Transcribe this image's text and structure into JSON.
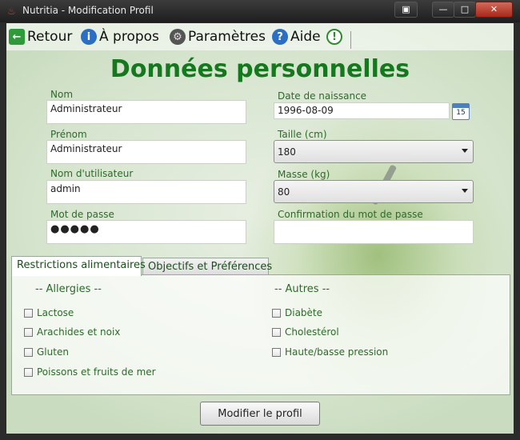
{
  "window": {
    "title": "Nutritia - Modification Profil",
    "controls": {
      "restore": "▣",
      "minimize": "—",
      "maximize": "□",
      "close": "✕"
    }
  },
  "toolbar": {
    "back_label": "Retour",
    "about_label": "À propos",
    "settings_label": "Paramètres",
    "help_label": "Aide"
  },
  "form": {
    "title": "Données personnelles",
    "nom": {
      "label": "Nom",
      "value": "Administrateur"
    },
    "prenom": {
      "label": "Prénom",
      "value": "Administrateur"
    },
    "username": {
      "label": "Nom d'utilisateur",
      "value": "admin"
    },
    "password": {
      "label": "Mot de passe",
      "value": "●●●●●"
    },
    "birthdate": {
      "label": "Date de naissance",
      "value": "1996-08-09",
      "calendar_day": "15"
    },
    "height": {
      "label": "Taille (cm)",
      "value": "180"
    },
    "mass": {
      "label": "Masse (kg)",
      "value": "80"
    },
    "confirm_password": {
      "label": "Confirmation du mot de passe",
      "value": ""
    }
  },
  "tabs": {
    "restrictions": "Restrictions alimentaires",
    "objectives": "Objectifs et Préférences"
  },
  "restrictions": {
    "allergies_header": "-- Allergies --",
    "others_header": "-- Autres --",
    "allergies": [
      "Lactose",
      "Arachides et noix",
      "Gluten",
      "Poissons et fruits de mer"
    ],
    "others": [
      "Diabète",
      "Cholestérol",
      "Haute/basse pression"
    ]
  },
  "submit_label": "Modifier le profil",
  "colors": {
    "heading": "#15781e",
    "label": "#2d6a2a"
  }
}
